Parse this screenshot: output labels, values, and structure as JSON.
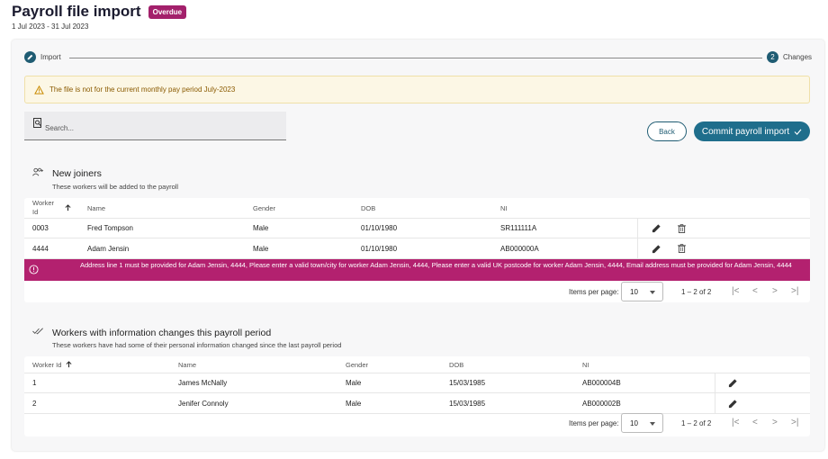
{
  "header": {
    "title": "Payroll file import",
    "badge": "Overdue",
    "period": "1 Jul 2023 - 31 Jul 2023"
  },
  "stepper": {
    "step1_label": "Import",
    "step2_number": "2",
    "step2_label": "Changes"
  },
  "warning": {
    "text": "The file is not for the current monthly pay period July-2023"
  },
  "search": {
    "placeholder": "Search..."
  },
  "actions": {
    "back_label": "Back",
    "commit_label": "Commit payroll import"
  },
  "new_joiners": {
    "title": "New joiners",
    "subtitle": "These workers will be added to the payroll",
    "columns": {
      "worker_id_line1": "Worker",
      "worker_id_line2": "Id",
      "name": "Name",
      "gender": "Gender",
      "dob": "DOB",
      "ni": "NI"
    },
    "rows": [
      {
        "worker_id": "0003",
        "name": "Fred Tompson",
        "gender": "Male",
        "dob": "01/10/1980",
        "ni": "SR111111A"
      },
      {
        "worker_id": "4444",
        "name": "Adam Jensin",
        "gender": "Male",
        "dob": "01/10/1980",
        "ni": "AB000000A"
      }
    ],
    "error": "Address line 1 must be provided for Adam Jensin, 4444, Please enter a valid town/city for worker Adam Jensin, 4444, Please enter a valid UK postcode for worker Adam Jensin, 4444, Email address must be provided for Adam Jensin, 4444",
    "pager": {
      "items_label": "Items per page:",
      "page_size": "10",
      "range": "1 – 2 of 2"
    }
  },
  "changes": {
    "title": "Workers with information changes this payroll period",
    "subtitle": "These workers have had some of their personal information changed since the last payroll period",
    "columns": {
      "worker_id": "Worker Id",
      "name": "Name",
      "gender": "Gender",
      "dob": "DOB",
      "ni": "NI"
    },
    "rows": [
      {
        "worker_id": "1",
        "name": "James McNally",
        "gender": "Male",
        "dob": "15/03/1985",
        "ni": "AB000004B"
      },
      {
        "worker_id": "2",
        "name": "Jenifer Connoly",
        "gender": "Male",
        "dob": "15/03/1985",
        "ni": "AB000002B"
      }
    ],
    "pager": {
      "items_label": "Items per page:",
      "page_size": "10",
      "range": "1 – 2 of 2"
    }
  },
  "colors": {
    "brand": "#1f6e8c",
    "badge": "#a3206b",
    "error": "#b3216f",
    "warning_bg": "#fcf7e5"
  }
}
